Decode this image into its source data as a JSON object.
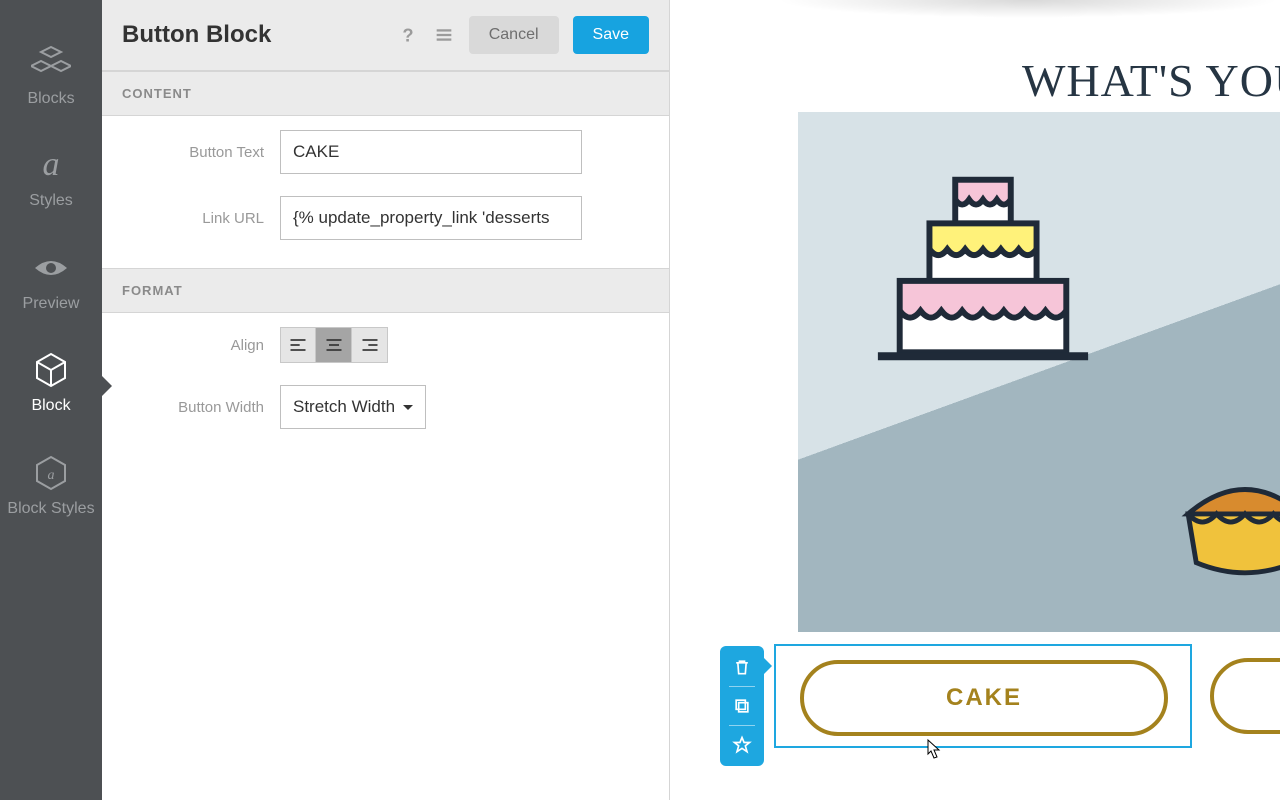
{
  "nav": {
    "items": [
      {
        "label": "Blocks"
      },
      {
        "label": "Styles"
      },
      {
        "label": "Preview"
      },
      {
        "label": "Block"
      },
      {
        "label": "Block Styles"
      }
    ]
  },
  "panel": {
    "title": "Button Block",
    "cancel_label": "Cancel",
    "save_label": "Save",
    "content_heading": "CONTENT",
    "format_heading": "FORMAT",
    "button_text_label": "Button Text",
    "button_text_value": "CAKE",
    "link_url_label": "Link URL",
    "link_url_value": "{% update_property_link 'desserts",
    "align_label": "Align",
    "button_width_label": "Button Width",
    "button_width_value": "Stretch Width"
  },
  "preview": {
    "headline": "WHAT'S YOUR F",
    "cake_button_label": "CAKE"
  }
}
